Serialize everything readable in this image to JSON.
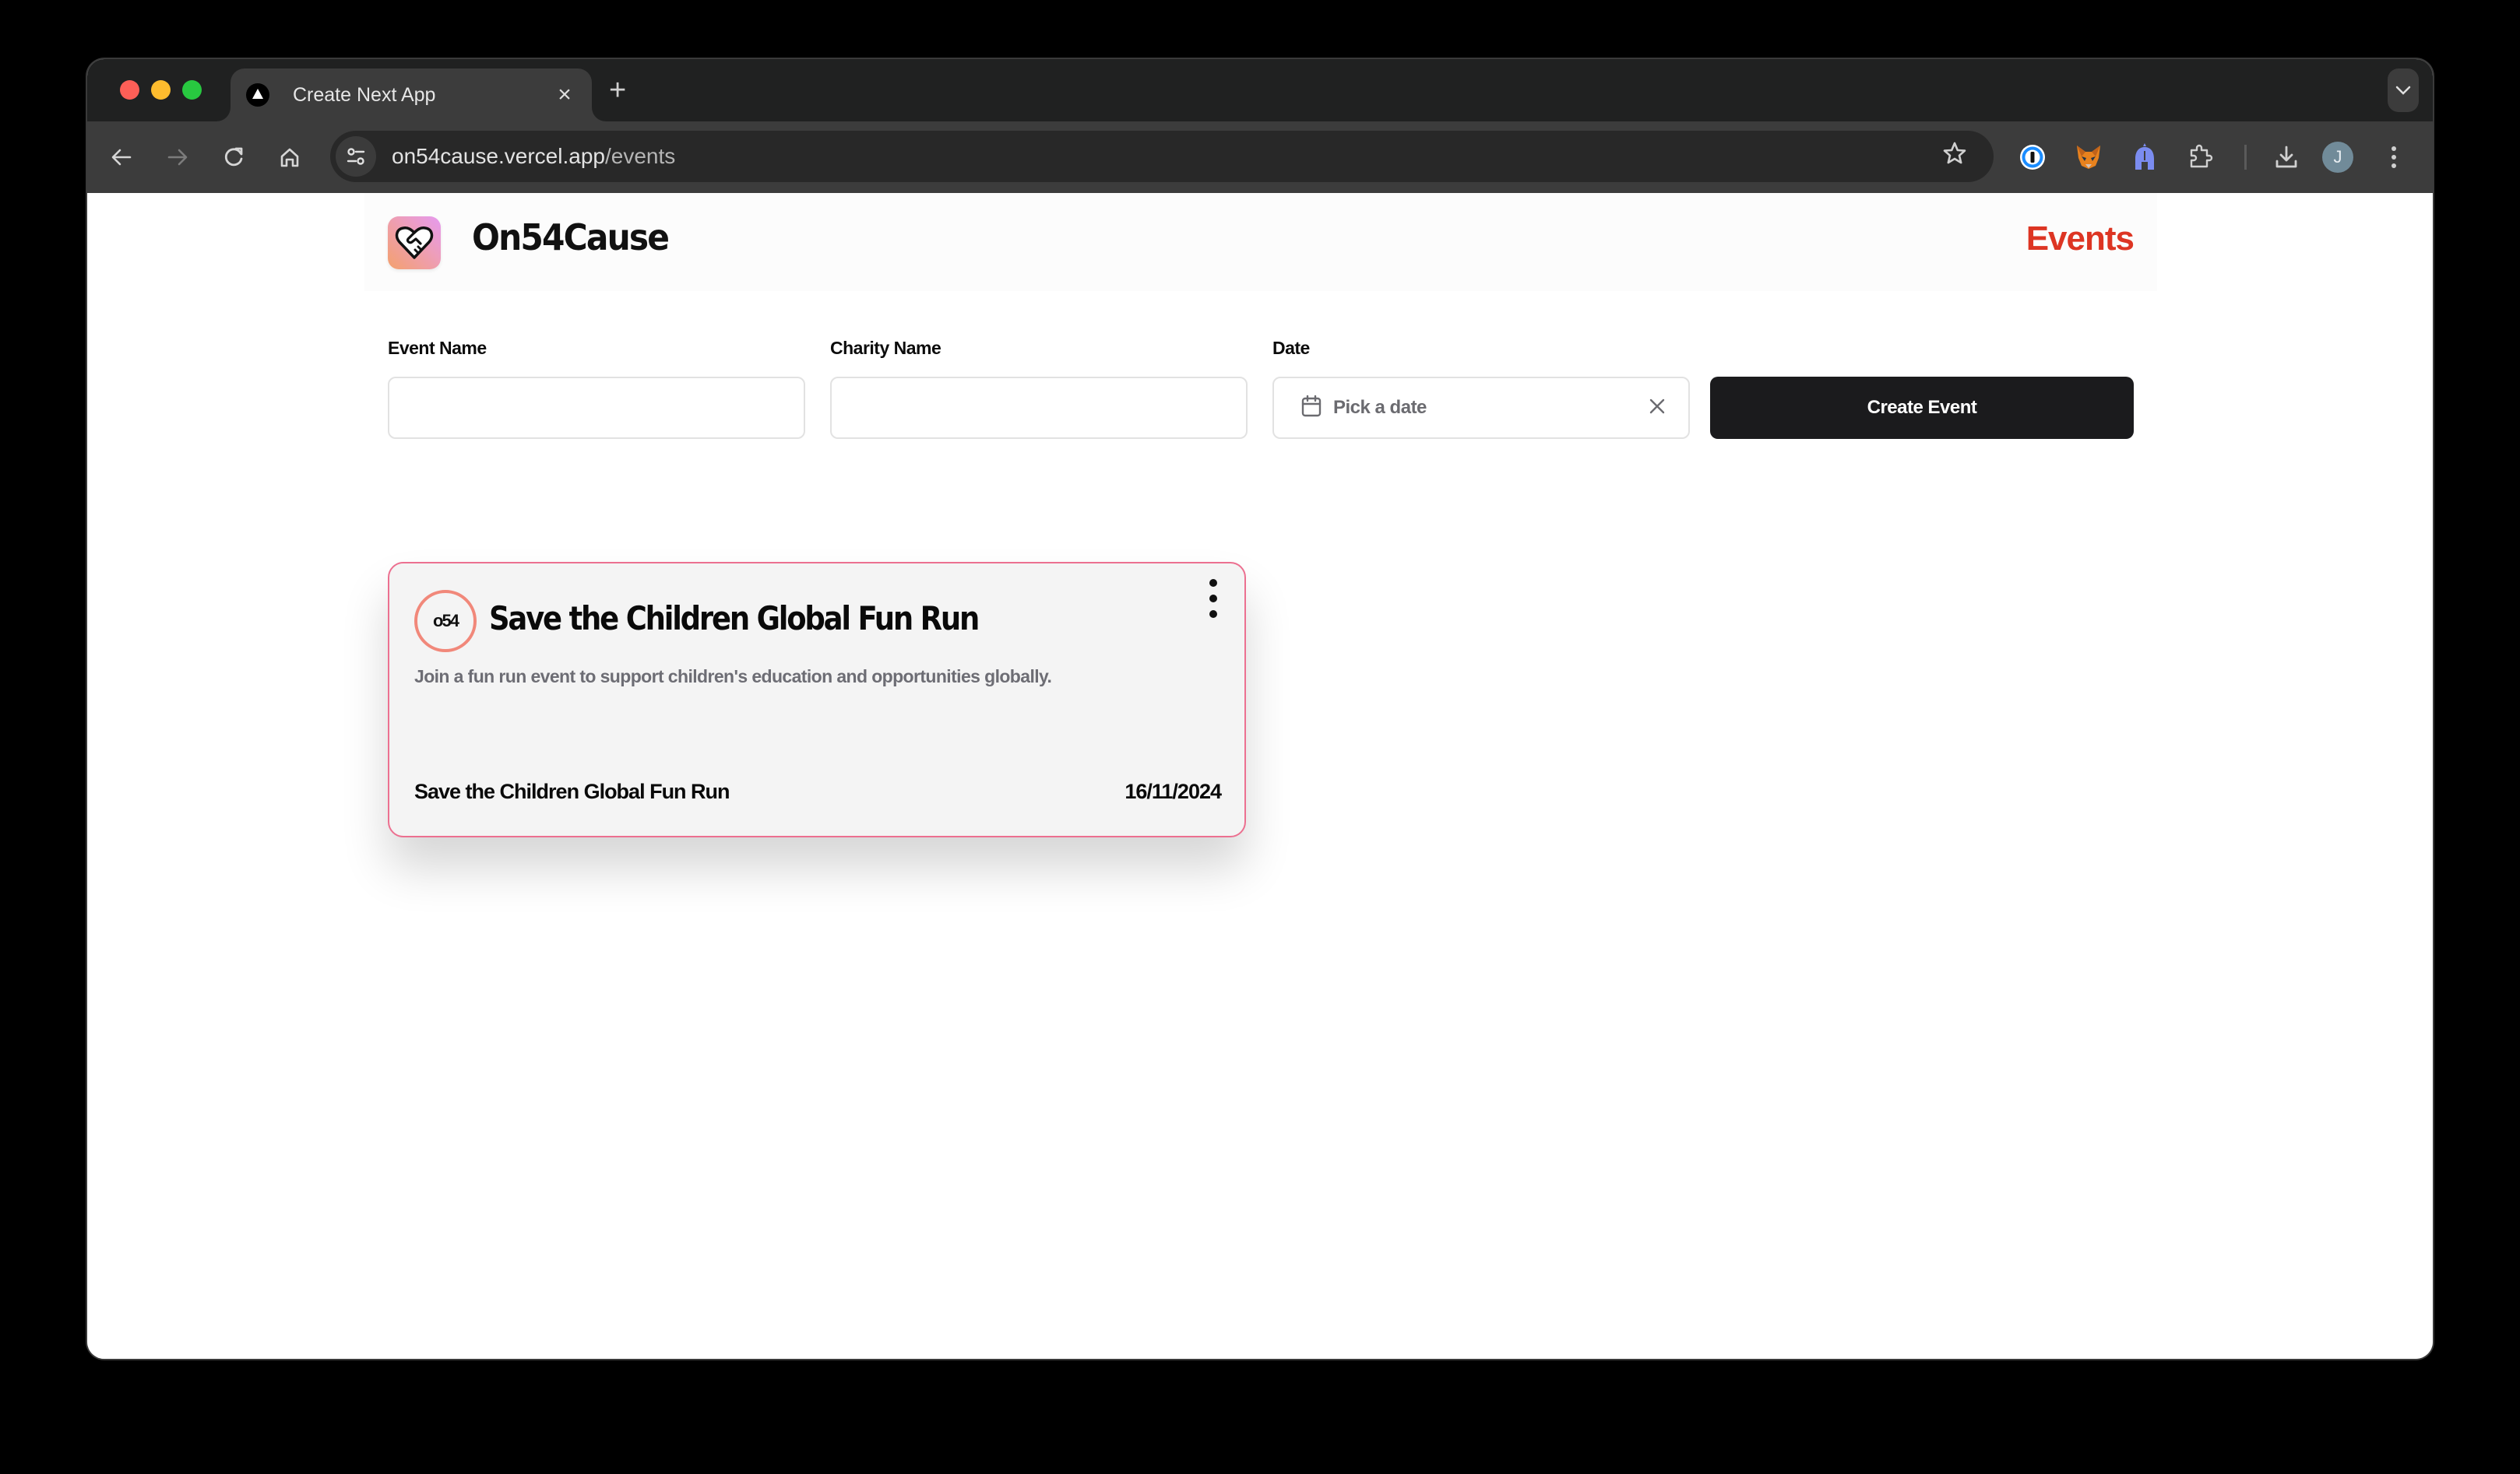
{
  "browser": {
    "tab": {
      "title": "Create Next App",
      "favicon": "nextjs-triangle-icon"
    },
    "new_tab_label": "+",
    "url_host": "on54cause.vercel.app",
    "url_path": "/events",
    "extensions": [
      "1password-icon",
      "metamask-fox-icon",
      "helmet-extension-icon",
      "puzzle-extensions-icon"
    ],
    "profile_initial": "J"
  },
  "header": {
    "brand": "On54Cause",
    "nav_link": "Events",
    "accent_color": "#dd3523"
  },
  "form": {
    "event_name": {
      "label": "Event Name",
      "value": "",
      "placeholder": ""
    },
    "charity_name": {
      "label": "Charity Name",
      "value": "",
      "placeholder": ""
    },
    "date": {
      "label": "Date",
      "placeholder": "Pick a date"
    },
    "submit_label": "Create Event"
  },
  "events": [
    {
      "badge": "o54",
      "title": "Save the Children Global Fun Run",
      "description": "Join a fun run event to support children's education and opportunities globally.",
      "charity": "Save the Children Global Fun Run",
      "date": "16/11/2024"
    }
  ]
}
